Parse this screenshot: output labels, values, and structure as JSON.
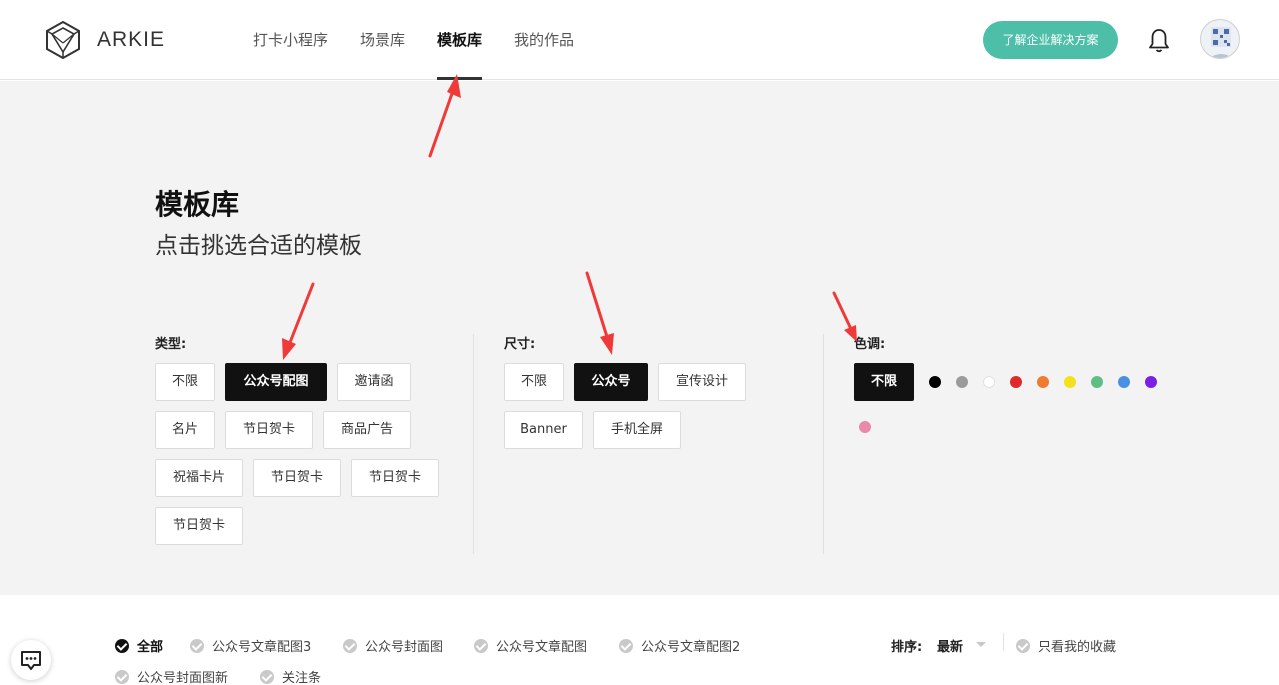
{
  "header": {
    "logo_text": "ARKIE",
    "nav": [
      {
        "label": "打卡小程序",
        "active": false
      },
      {
        "label": "场景库",
        "active": false
      },
      {
        "label": "模板库",
        "active": true
      },
      {
        "label": "我的作品",
        "active": false
      }
    ],
    "cta_label": "了解企业解决方案"
  },
  "hero": {
    "title": "模板库",
    "subtitle": "点击挑选合适的模板"
  },
  "type_filter": {
    "label": "类型:",
    "options": [
      "不限",
      "公众号配图",
      "邀请函",
      "名片",
      "节日贺卡",
      "商品广告",
      "祝福卡片",
      "节日贺卡",
      "节日贺卡",
      "节日贺卡"
    ],
    "selected": "公众号配图"
  },
  "size_filter": {
    "label": "尺寸:",
    "options": [
      "不限",
      "公众号",
      "宣传设计",
      "Banner",
      "手机全屏"
    ],
    "selected": "公众号"
  },
  "color_filter": {
    "label": "色调:",
    "any_label": "不限",
    "colors": [
      "#000000",
      "#9b9b9b",
      "#ffffff",
      "#e02a2a",
      "#f07a30",
      "#f5e11a",
      "#5dbf84",
      "#4a90e2",
      "#7b1fe6",
      "#e98aa8"
    ]
  },
  "category_bar": {
    "items": [
      {
        "label": "全部",
        "active": true
      },
      {
        "label": "公众号文章配图3",
        "active": false
      },
      {
        "label": "公众号封面图",
        "active": false
      },
      {
        "label": "公众号文章配图",
        "active": false
      },
      {
        "label": "公众号文章配图2",
        "active": false
      },
      {
        "label": "公众号封面图新",
        "active": false
      },
      {
        "label": "关注条",
        "active": false
      }
    ],
    "sort_label": "排序:",
    "sort_value": "最新",
    "favorites_label": "只看我的收藏"
  },
  "colors": {
    "accent": "#4dbfa8",
    "annotation_arrow": "#f03a3a"
  }
}
